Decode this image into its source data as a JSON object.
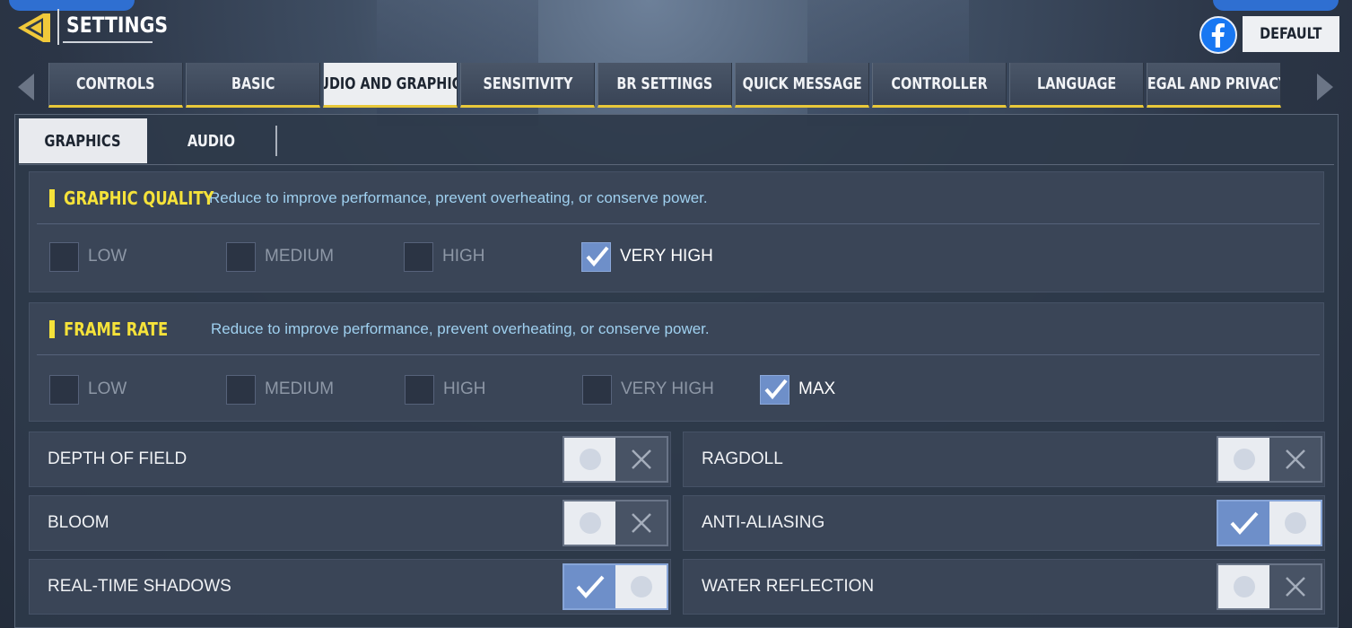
{
  "header": {
    "title": "SETTINGS",
    "back_icon": "back-arrow-icon",
    "facebook_icon": "facebook-icon",
    "default_label": "DEFAULT"
  },
  "tabs": [
    {
      "label": "CONTROLS",
      "active": false
    },
    {
      "label": "BASIC",
      "active": false
    },
    {
      "label": "AUDIO AND GRAPHICS",
      "active": true
    },
    {
      "label": "SENSITIVITY",
      "active": false
    },
    {
      "label": "BR SETTINGS",
      "active": false
    },
    {
      "label": "QUICK MESSAGE",
      "active": false
    },
    {
      "label": "CONTROLLER",
      "active": false
    },
    {
      "label": "LANGUAGE",
      "active": false
    },
    {
      "label": "LEGAL AND PRIVACY",
      "active": false
    }
  ],
  "subtabs": [
    {
      "label": "GRAPHICS",
      "active": true
    },
    {
      "label": "AUDIO",
      "active": false
    }
  ],
  "graphic_quality": {
    "title": "GRAPHIC QUALITY",
    "description": "Reduce to improve performance, prevent overheating, or conserve power.",
    "options": [
      {
        "label": "LOW",
        "checked": false
      },
      {
        "label": "MEDIUM",
        "checked": false
      },
      {
        "label": "HIGH",
        "checked": false
      },
      {
        "label": "VERY HIGH",
        "checked": true
      }
    ]
  },
  "frame_rate": {
    "title": "FRAME RATE",
    "description": "Reduce to improve performance, prevent overheating, or conserve power.",
    "options": [
      {
        "label": "LOW",
        "checked": false
      },
      {
        "label": "MEDIUM",
        "checked": false
      },
      {
        "label": "HIGH",
        "checked": false
      },
      {
        "label": "VERY HIGH",
        "checked": false
      },
      {
        "label": "MAX",
        "checked": true
      }
    ]
  },
  "toggles": [
    {
      "label": "DEPTH OF FIELD",
      "on": false
    },
    {
      "label": "RAGDOLL",
      "on": false
    },
    {
      "label": "BLOOM",
      "on": false
    },
    {
      "label": "ANTI-ALIASING",
      "on": true
    },
    {
      "label": "REAL-TIME SHADOWS",
      "on": true
    },
    {
      "label": "WATER REFLECTION",
      "on": false
    }
  ],
  "colors": {
    "accent_yellow": "#f5e23a",
    "toggle_on": "#6e8fc9",
    "description_text": "#9fd0ef"
  }
}
